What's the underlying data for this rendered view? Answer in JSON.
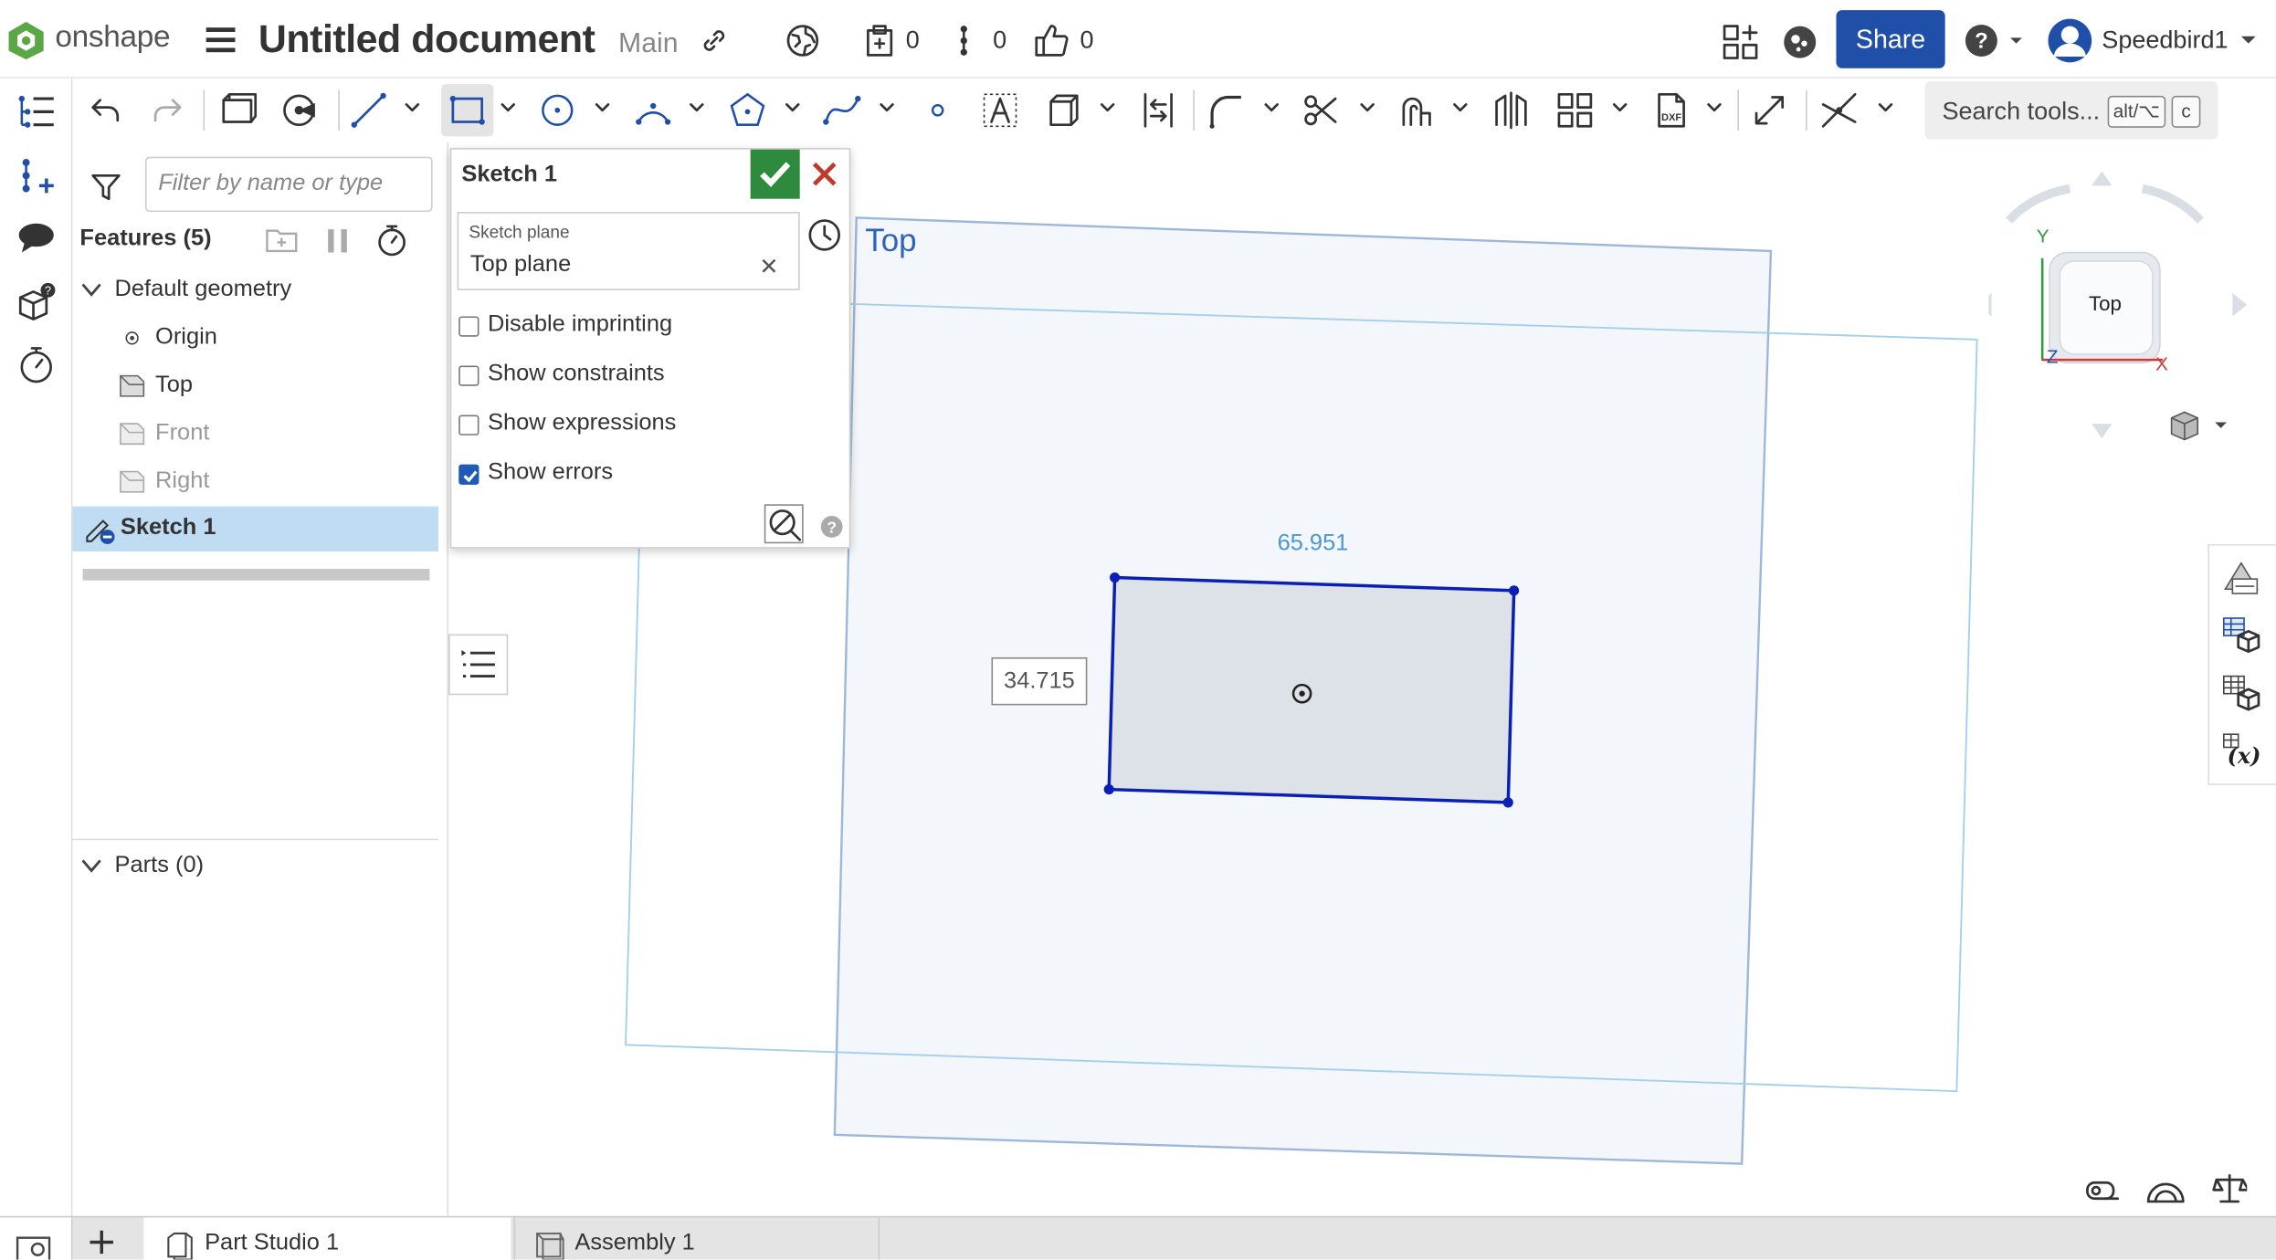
{
  "header": {
    "logo_text": "onshape",
    "document_title": "Untitled document",
    "branch": "Main",
    "versions_count": "0",
    "branches_count": "0",
    "likes_count": "0",
    "share_label": "Share",
    "user_name": "Speedbird1"
  },
  "toolbar": {
    "search_label": "Search tools...",
    "shortcut_key1": "alt/⌥",
    "shortcut_key2": "c"
  },
  "feature_panel": {
    "filter_placeholder": "Filter by name or type",
    "features_heading": "Features (5)",
    "items": [
      {
        "label": "Default geometry"
      },
      {
        "label": "Origin"
      },
      {
        "label": "Top"
      },
      {
        "label": "Front"
      },
      {
        "label": "Right"
      },
      {
        "label": "Sketch 1"
      }
    ],
    "parts_heading": "Parts (0)"
  },
  "sketch_dialog": {
    "title": "Sketch 1",
    "plane_label": "Sketch plane",
    "plane_value": "Top plane",
    "options": [
      {
        "label": "Disable imprinting",
        "checked": false
      },
      {
        "label": "Show constraints",
        "checked": false
      },
      {
        "label": "Show expressions",
        "checked": false
      },
      {
        "label": "Show errors",
        "checked": true
      }
    ]
  },
  "viewport": {
    "plane_name": "Top",
    "width_dimension": "65.951",
    "height_dimension": "34.715",
    "view_cube_face": "Top",
    "axis_y": "Y",
    "axis_x": "X",
    "axis_z": "Z"
  },
  "tabs": [
    {
      "label": "Part Studio 1",
      "active": true
    },
    {
      "label": "Assembly 1",
      "active": false
    }
  ],
  "colors": {
    "accent": "#1f4fa8",
    "selection": "#bfdcf3",
    "confirm": "#2e8a3c",
    "cancel": "#c0392b",
    "sketch_line": "#0a1fb5",
    "plane_outline": "#9db7d8"
  }
}
